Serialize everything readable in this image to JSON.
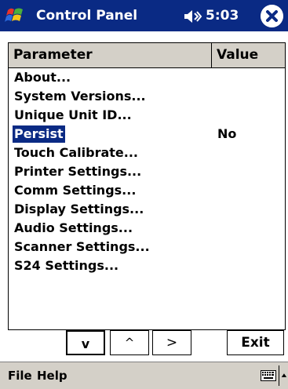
{
  "titlebar": {
    "title": "Control Panel",
    "time": "5:03",
    "bg_color": "#0a2a84",
    "icons": [
      "windows-start-icon",
      "volume-icon",
      "close-icon"
    ]
  },
  "grid": {
    "columns": [
      "Parameter",
      "Value"
    ],
    "rows": [
      {
        "label": "About...",
        "value": ""
      },
      {
        "label": "System Versions...",
        "value": ""
      },
      {
        "label": "Unique Unit ID...",
        "value": ""
      },
      {
        "label": "Persist",
        "value": "No",
        "selected": true
      },
      {
        "label": "Touch Calibrate...",
        "value": ""
      },
      {
        "label": "Printer Settings...",
        "value": ""
      },
      {
        "label": "Comm Settings...",
        "value": ""
      },
      {
        "label": "Display Settings...",
        "value": ""
      },
      {
        "label": "Audio Settings...",
        "value": ""
      },
      {
        "label": "Scanner Settings...",
        "value": ""
      },
      {
        "label": "S24 Settings...",
        "value": ""
      }
    ],
    "selection_color": "#0a2a84"
  },
  "buttons": {
    "down": "v",
    "up": "^",
    "right": ">",
    "exit": "Exit"
  },
  "menubar": {
    "file": "File",
    "help": "Help",
    "icons": [
      "keyboard-icon",
      "sip-arrow-icon"
    ]
  }
}
